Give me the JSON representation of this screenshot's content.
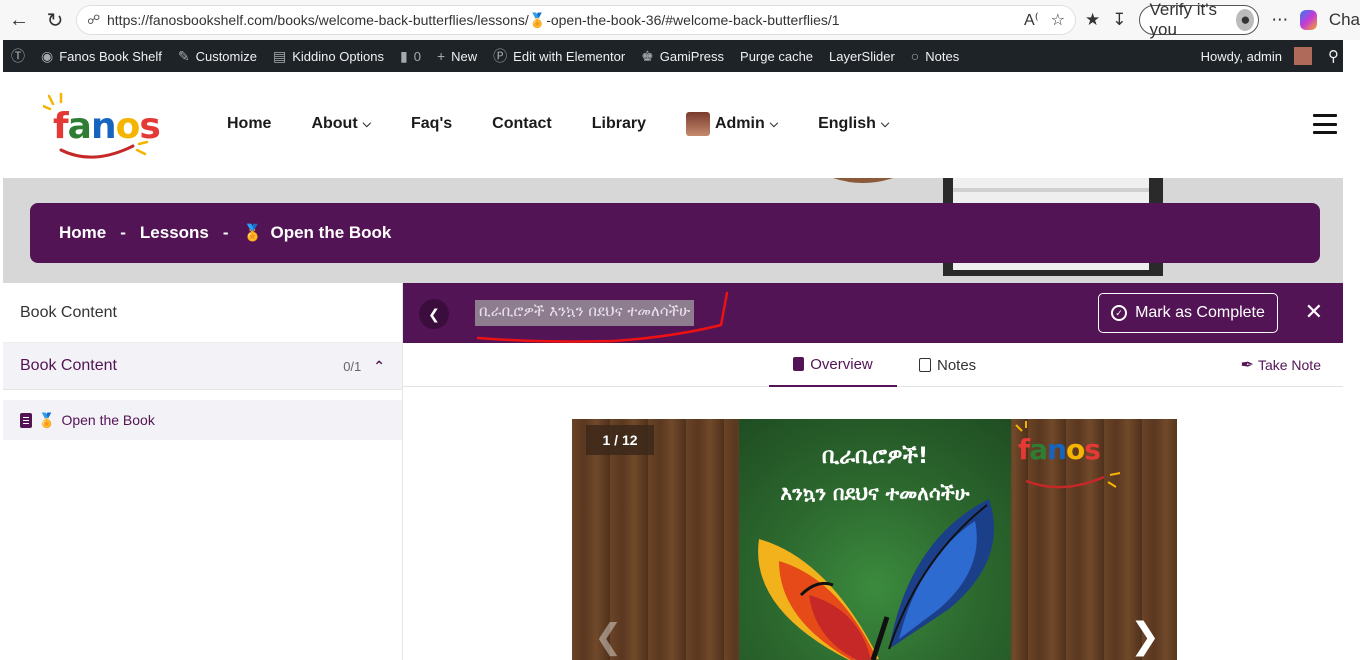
{
  "browser": {
    "url": "https://fanosbookshelf.com/books/welcome-back-butterflies/lessons/🏅-open-the-book-36/#welcome-back-butterflies/1",
    "verify_label": "Verify it's you",
    "cha_label": "Cha"
  },
  "wp_bar": {
    "site_name": "Fanos Book Shelf",
    "customize": "Customize",
    "kiddino": "Kiddino Options",
    "comments_count": "0",
    "new": "New",
    "elementor": "Edit with Elementor",
    "gamipress": "GamiPress",
    "purge": "Purge cache",
    "layerslider": "LayerSlider",
    "notes": "Notes",
    "howdy": "Howdy, admin"
  },
  "header": {
    "logo_text": "fanos",
    "nav": {
      "home": "Home",
      "about": "About",
      "faqs": "Faq's",
      "contact": "Contact",
      "library": "Library",
      "admin": "Admin",
      "english": "English"
    }
  },
  "breadcrumb": {
    "home": "Home",
    "sep1": "-",
    "lessons": "Lessons",
    "sep2": "-",
    "current": "Open the Book"
  },
  "sidebar": {
    "title": "Book Content",
    "section_label": "Book Content",
    "section_count": "0/1",
    "item_label": "Open the Book"
  },
  "lesson": {
    "title": "ቢራቢሮዎች እንኳን በደህና ተመለሳችሁ",
    "mark_complete": "Mark as Complete"
  },
  "tabs": {
    "overview": "Overview",
    "notes": "Notes",
    "take_note": "Take Note"
  },
  "viewer": {
    "page_counter": "1 / 12",
    "cover_line1": "ቢራቢሮዎች!",
    "cover_line2": "እንኳን በደህና ተመለሳችሁ",
    "mini_logo": "fanos"
  },
  "colors": {
    "brand_purple": "#531455",
    "wp_bar": "#1d2327"
  }
}
